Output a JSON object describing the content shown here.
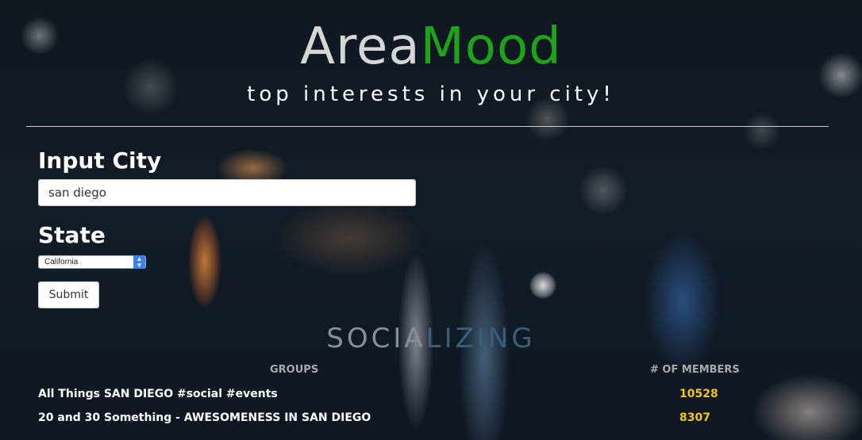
{
  "header": {
    "logo_area": "Area",
    "logo_mood": "Mood",
    "tagline": "top interests in your city!"
  },
  "form": {
    "city_label": "Input City",
    "city_value": "san diego",
    "state_label": "State",
    "state_selected": "California",
    "submit_label": "Submit"
  },
  "results": {
    "category_part1": "SOCIA",
    "category_part2": "LIZING",
    "col_groups": "GROUPS",
    "col_members": "# OF MEMBERS",
    "rows": [
      {
        "name": "All Things SAN DIEGO #social #events",
        "members": "10528"
      },
      {
        "name": "20 and 30 Something - AWESOMENESS IN SAN DIEGO",
        "members": "8307"
      }
    ]
  },
  "colors": {
    "accent_green": "#1fa31a",
    "member_count": "#f5c518",
    "select_chevron": "#3b82f0"
  },
  "icons": {
    "select": "chevron-up-down-icon"
  }
}
